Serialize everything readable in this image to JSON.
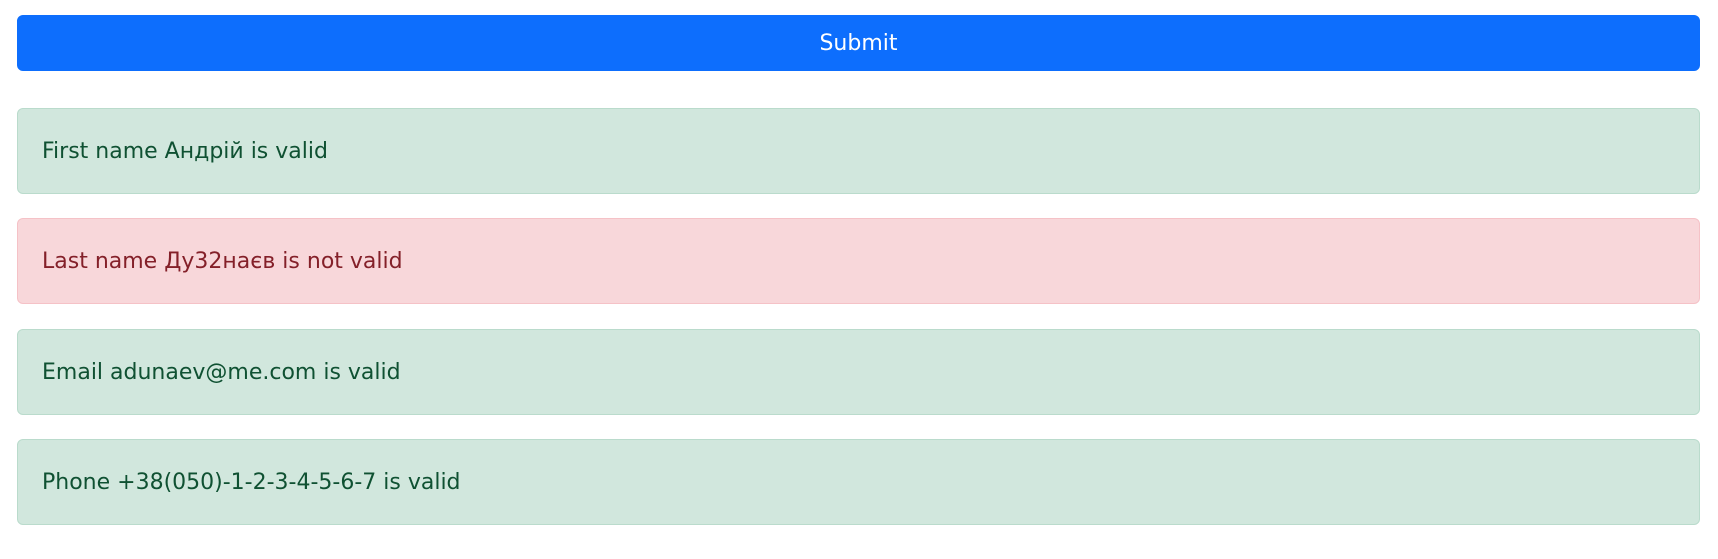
{
  "form": {
    "submit_label": "Submit"
  },
  "results": [
    {
      "text": "First name Андрій is valid",
      "status": "valid"
    },
    {
      "text": "Last name Ду32наєв is not valid",
      "status": "invalid"
    },
    {
      "text": "Email adunaev@me.com is valid",
      "status": "valid"
    },
    {
      "text": "Phone +38(050)-1-2-3-4-5-6-7 is valid",
      "status": "valid"
    }
  ],
  "colors": {
    "primary": "#0d6efd",
    "success_bg": "#d1e7dd",
    "success_text": "#0f5132",
    "danger_bg": "#f8d7da",
    "danger_text": "#842029"
  }
}
